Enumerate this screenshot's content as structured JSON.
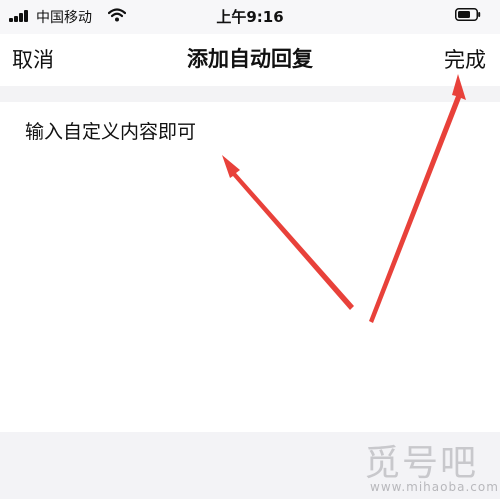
{
  "status_bar": {
    "carrier": "中国移动",
    "time": "上午9:16",
    "icons": [
      "signal-icon",
      "wifi-icon",
      "battery-icon"
    ]
  },
  "nav": {
    "cancel_label": "取消",
    "title": "添加自动回复",
    "done_label": "完成"
  },
  "editor": {
    "text": "输入自定义内容即可"
  },
  "annotations": {
    "arrow_color": "#e8413a",
    "arrows": [
      "arrow-to-done",
      "arrow-to-text"
    ]
  },
  "watermark": {
    "main": "觅号吧",
    "sub": "www.mihaoba.com"
  }
}
